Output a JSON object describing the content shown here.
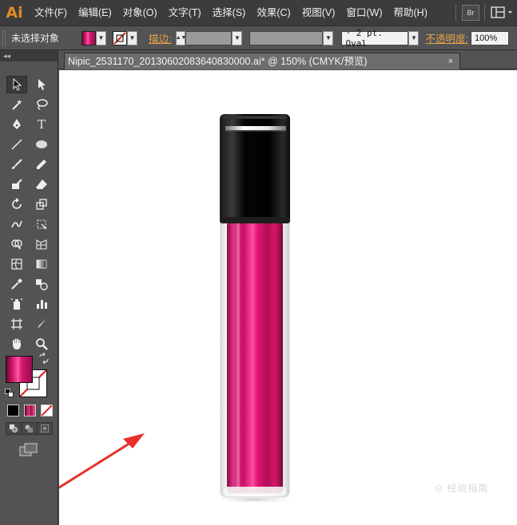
{
  "app": {
    "logo": "Ai"
  },
  "menubar": {
    "items": [
      "文件(F)",
      "编辑(E)",
      "对象(O)",
      "文字(T)",
      "选择(S)",
      "效果(C)",
      "视图(V)",
      "窗口(W)",
      "帮助(H)"
    ],
    "bridge_label": "Br"
  },
  "controlbar": {
    "selection_status": "未选择对象",
    "stroke_label": "描边:",
    "brush_value": "· 2 pt. Oval",
    "opacity_label": "不透明度:",
    "opacity_value": "100%",
    "fill_color": "#d6186c",
    "stroke_color": "none"
  },
  "toolbox": {
    "collapse_glyph": "◂◂",
    "fill_color": "#d6186c",
    "stroke_color": "none"
  },
  "document": {
    "tab_title": "Nipic_2531170_20130602083640830000.ai*  @  150%  (CMYK/预览)",
    "close_glyph": "×"
  },
  "artwork": {
    "subject": "lip-gloss-tube",
    "cap_color": "#0a0a0a",
    "body_color": "#d6186c",
    "annotation_arrow_color": "#e8302a"
  },
  "watermark": {
    "text": "⊙ 经验指南"
  }
}
